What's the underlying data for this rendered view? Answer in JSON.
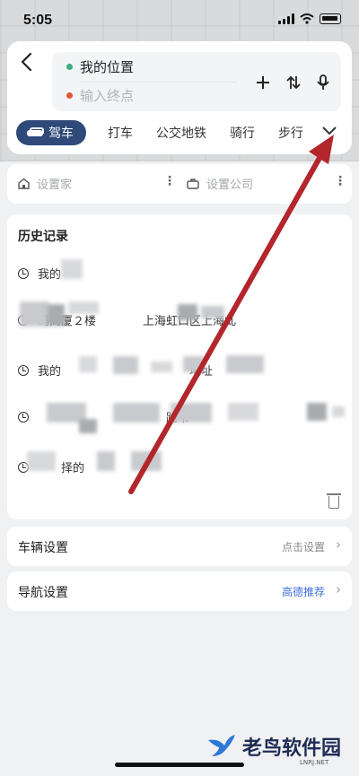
{
  "status_bar": {
    "time": "5:05"
  },
  "route": {
    "from": "我的位置",
    "to_placeholder": "输入终点",
    "actions": [
      "+",
      "⇅",
      "🎤"
    ]
  },
  "modes": [
    {
      "label": "驾车",
      "active": true
    },
    {
      "label": "打车",
      "active": false
    },
    {
      "label": "公交地铁",
      "active": false
    },
    {
      "label": "骑行",
      "active": false
    },
    {
      "label": "步行",
      "active": false
    }
  ],
  "shortcuts": {
    "home": "设置家",
    "company": "设置公司"
  },
  "history": {
    "title": "历史记录",
    "items": [
      "我的",
      "码商厦２楼　　　　上海虹口区上海虬",
      "我的　　　　　　　　　　　地址",
      "　　　　　　　　　　　路韦",
      "　　择的"
    ]
  },
  "settings": [
    {
      "label": "车辆设置",
      "value": "点击设置",
      "accent": false
    },
    {
      "label": "导航设置",
      "value": "高德推荐",
      "accent": true
    }
  ],
  "watermark": {
    "text": "老鸟软件园",
    "sub": "LNRJ.NET"
  },
  "colors": {
    "mode_active": "#2f4a79",
    "accent": "#3d6fd6",
    "arrow": "#b3262b"
  }
}
